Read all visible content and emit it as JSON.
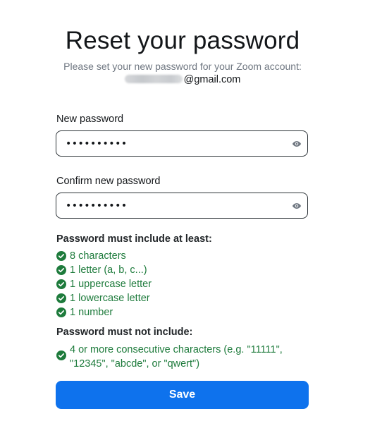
{
  "header": {
    "title": "Reset your password",
    "subtitle": "Please set your new password for your Zoom account:",
    "email_domain": "@gmail.com"
  },
  "form": {
    "new_password": {
      "label": "New password",
      "value": "••••••••••",
      "icon": "eye-icon"
    },
    "confirm_password": {
      "label": "Confirm new password",
      "value": "••••••••••",
      "icon": "eye-icon"
    }
  },
  "requirements": {
    "must_include_heading": "Password must include at least:",
    "must_include": [
      "8 characters",
      "1 letter (a, b, c...)",
      "1 uppercase letter",
      "1 lowercase letter",
      "1 number"
    ],
    "must_not_include_heading": "Password must not include:",
    "must_not_include": [
      "4 or more consecutive characters (e.g. \"11111\", \"12345\", \"abcde\", or \"qwert\")"
    ],
    "status_icon": "check-circle-icon"
  },
  "actions": {
    "save_label": "Save"
  },
  "colors": {
    "primary": "#0e72ed",
    "success": "#1e7b3c",
    "text": "#131619",
    "muted": "#6e7680"
  }
}
